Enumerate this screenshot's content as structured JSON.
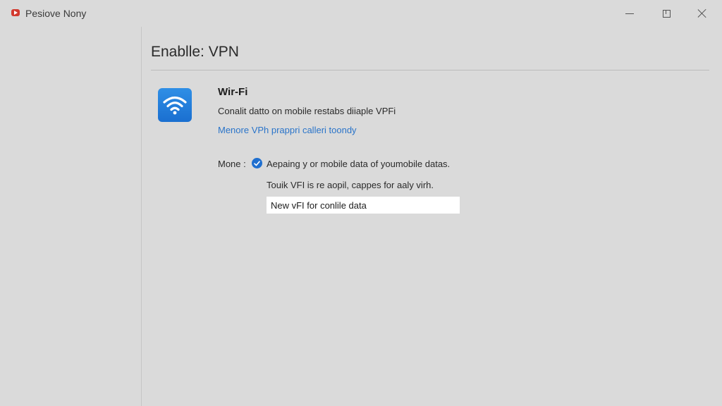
{
  "window": {
    "title": "Pesiove Nony"
  },
  "page": {
    "title": "Enablle: VPN"
  },
  "wifi": {
    "icon": "wifi-icon",
    "title": "Wir-Fi",
    "description": "Conalit datto on mobile restabs diiaple VPFi",
    "link": "Menore VPh prappri calleri toondy"
  },
  "mode": {
    "label": "Mone :",
    "checked": true,
    "option_label": "Aepaing y or mobile data of youmobile datas.",
    "sub_text": "Touik VFI is re aopil, cappes for aaly virh.",
    "input_value": "New vFI for conlile data"
  },
  "colors": {
    "accent": "#1f6fcf",
    "link": "#2a74c9",
    "app_icon": "#d23a2f"
  }
}
